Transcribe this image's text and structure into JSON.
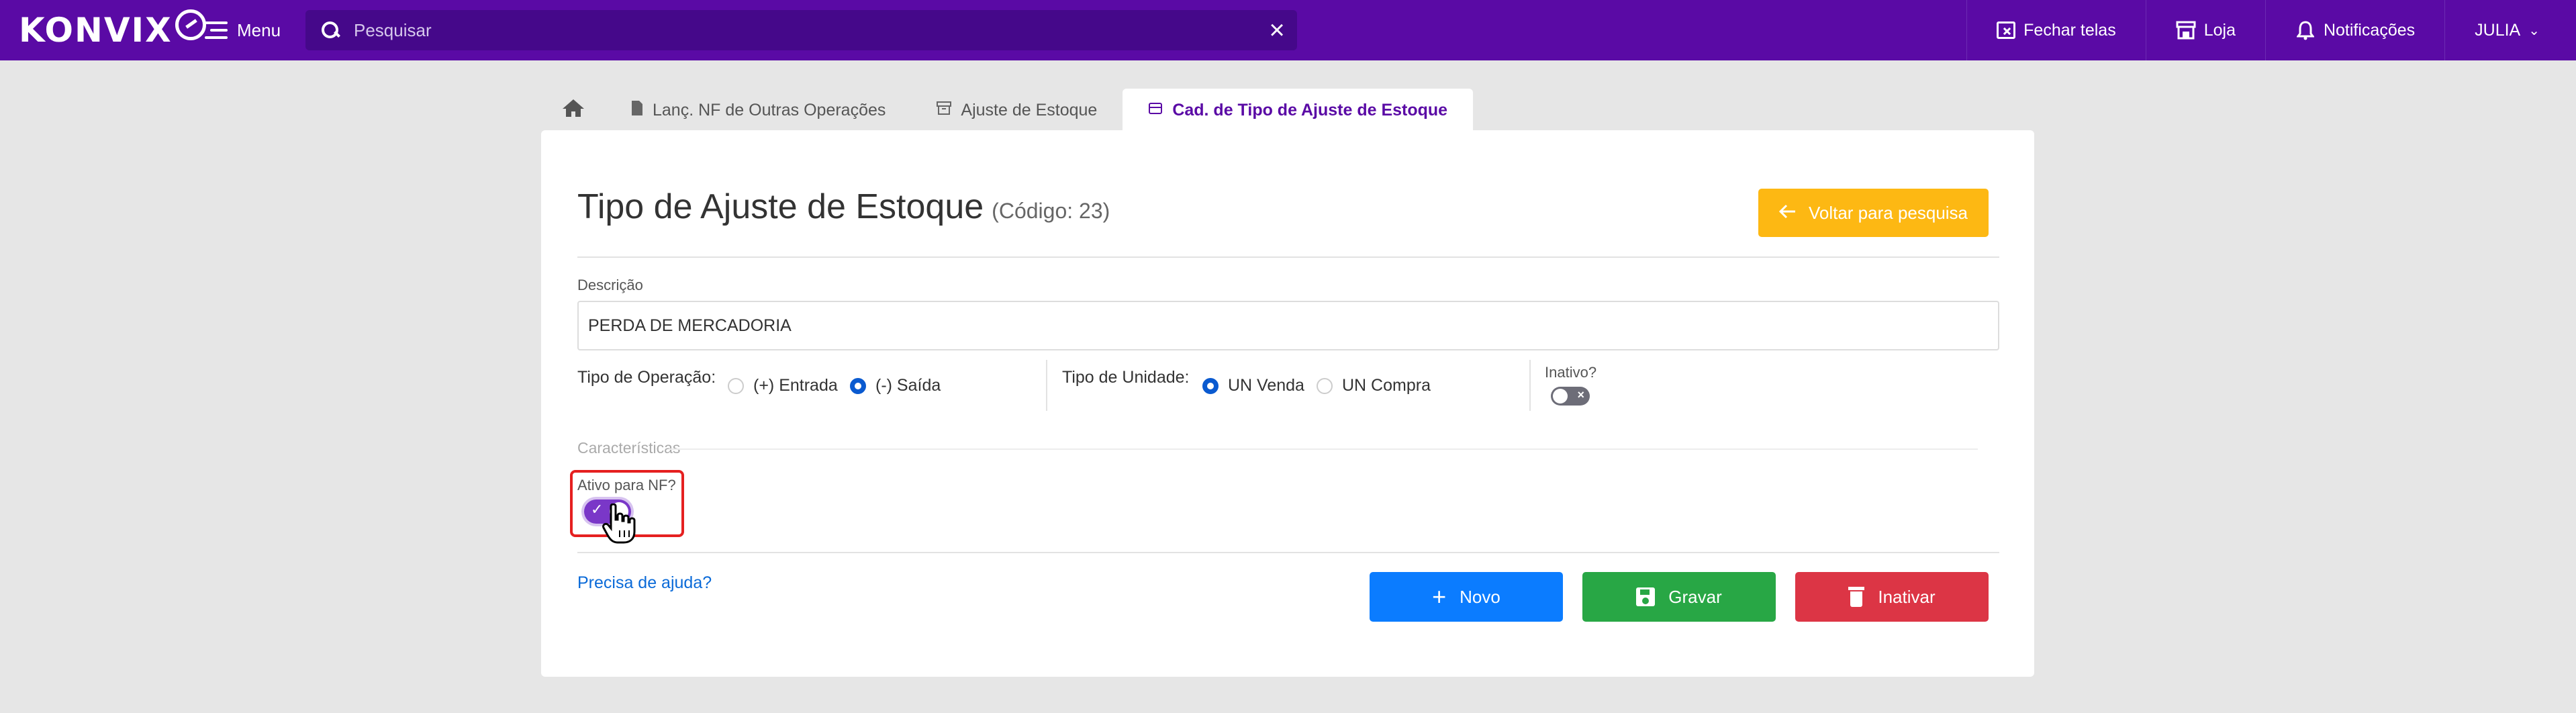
{
  "topbar": {
    "logo": "KONVIX",
    "menu_label": "Menu",
    "search_placeholder": "Pesquisar",
    "fechar_telas": "Fechar telas",
    "loja": "Loja",
    "notificacoes": "Notificações",
    "user": "JULIA"
  },
  "tabs": [
    {
      "label": "Lanç. NF de Outras Operações"
    },
    {
      "label": "Ajuste de Estoque"
    },
    {
      "label": "Cad. de Tipo de Ajuste de Estoque"
    }
  ],
  "form": {
    "title": "Tipo de Ajuste de Estoque",
    "code": "(Código: 23)",
    "back_label": "Voltar para pesquisa",
    "descricao_label": "Descrição",
    "descricao_value": "PERDA DE MERCADORIA",
    "tipo_operacao_label": "Tipo de Operação:",
    "op_entrada": "(+) Entrada",
    "op_saida": "(-) Saída",
    "tipo_unidade_label": "Tipo de Unidade:",
    "un_venda": "UN Venda",
    "un_compra": "UN Compra",
    "inativo_label": "Inativo?",
    "caracteristicas_label": "Características",
    "ativo_nf_label": "Ativo para NF?",
    "help_label": "Precisa de ajuda?",
    "novo_label": "Novo",
    "gravar_label": "Gravar",
    "inativar_label": "Inativar"
  },
  "colors": {
    "topbar": "#5a0aa5",
    "accent": "#fdb813",
    "primary": "#0b7cff",
    "success": "#28a745",
    "danger": "#dc3545"
  }
}
